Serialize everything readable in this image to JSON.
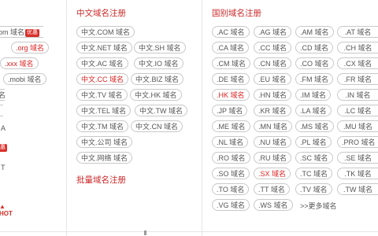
{
  "left_fragments": {
    "com_partial": "om 域名",
    "badge": "优惠",
    "org": ".org 域名",
    "xxx": ".xxx 域名",
    "mobi": ".mobi 域名",
    "frag_a": "名",
    "frag_b": "A",
    "frag_c": "惠",
    "frag_d": "T"
  },
  "chinese_domains": {
    "title": "中文域名注册",
    "items": [
      "中文.COM 域名",
      "中文.NET 域名",
      "中文.SH 域名",
      "中文.AC 域名",
      "中文.IO 域名",
      "中文.CC 域名",
      "中文.BIZ 域名",
      "中文.TV 域名",
      "中文.HK 域名",
      "中文.TEL 域名",
      "中文.TW 域名",
      "中文.TM 域名",
      "中文.CN 域名",
      "中文.公司 域名",
      "中文.网络 域名"
    ],
    "bulk_title": "批量域名注册"
  },
  "intl_domains": {
    "title": "国别域名注册",
    "rows": [
      [
        ".AC 域名",
        ".AG 域名",
        ".AM 域名",
        ".AT 域名"
      ],
      [
        ".CA 域名",
        ".CC 域名",
        ".CD 域名",
        ".CH 域名"
      ],
      [
        ".CM 域名",
        ".CN 域名",
        ".CO 域名",
        ".CX 域名"
      ],
      [
        ".DE 域名",
        ".EU 域名",
        ".FM 域名",
        ".FR 域名"
      ],
      [
        ".HK 域名",
        ".HN 域名",
        ".IM 域名",
        ".IN 域名"
      ],
      [
        ".JP 域名",
        ".KR 域名",
        ".LA 域名",
        ".LC 域名"
      ],
      [
        ".ME 域名",
        ".MN 域名",
        ".MS 域名",
        ".MU 域名"
      ],
      [
        ".NL 域名",
        ".NU 域名",
        ".PL 域名",
        ".PRO 域名"
      ],
      [
        ".RO 域名",
        ".RU 域名",
        ".SC 域名",
        ".SE 域名"
      ],
      [
        ".SO 域名",
        ".SX 域名",
        ".TC 域名",
        ".TK 域名"
      ],
      [
        ".TO 域名",
        ".TT 域名",
        ".TV 域名",
        ".TW 域名"
      ],
      [
        ".VG 域名",
        ".WS 域名"
      ]
    ],
    "more": ">>更多域名"
  },
  "colors": {
    "accent": "#cc2a2a",
    "border": "#c8c8c8"
  }
}
